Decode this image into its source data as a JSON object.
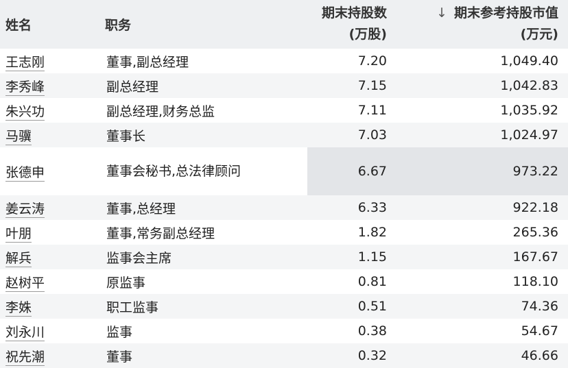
{
  "headers": {
    "name": "姓名",
    "role": "职务",
    "shares_line1": "期末持股数",
    "shares_line2": "(万股)",
    "value_sort_icon": "↓",
    "value_line1": "期末参考持股市值",
    "value_line2": "(万元)"
  },
  "rows": [
    {
      "name": "王志刚",
      "role": "董事,副总经理",
      "shares": "7.20",
      "value": "1,049.40"
    },
    {
      "name": "李秀峰",
      "role": "副总经理",
      "shares": "7.15",
      "value": "1,042.83"
    },
    {
      "name": "朱兴功",
      "role": "副总经理,财务总监",
      "shares": "7.11",
      "value": "1,035.92"
    },
    {
      "name": "马骥",
      "role": "董事长",
      "shares": "7.03",
      "value": "1,024.97"
    },
    {
      "name": "张德申",
      "role": "董事会秘书,总法律顾问",
      "shares": "6.67",
      "value": "973.22"
    },
    {
      "name": "姜云涛",
      "role": "董事,总经理",
      "shares": "6.33",
      "value": "922.18"
    },
    {
      "name": "叶朋",
      "role": "董事,常务副总经理",
      "shares": "1.82",
      "value": "265.36"
    },
    {
      "name": "解兵",
      "role": "监事会主席",
      "shares": "1.15",
      "value": "167.67"
    },
    {
      "name": "赵树平",
      "role": "原监事",
      "shares": "0.81",
      "value": "118.10"
    },
    {
      "name": "李姝",
      "role": "职工监事",
      "shares": "0.51",
      "value": "74.36"
    },
    {
      "name": "刘永川",
      "role": "监事",
      "shares": "0.38",
      "value": "54.67"
    },
    {
      "name": "祝先潮",
      "role": "董事",
      "shares": "0.32",
      "value": "46.66"
    }
  ]
}
